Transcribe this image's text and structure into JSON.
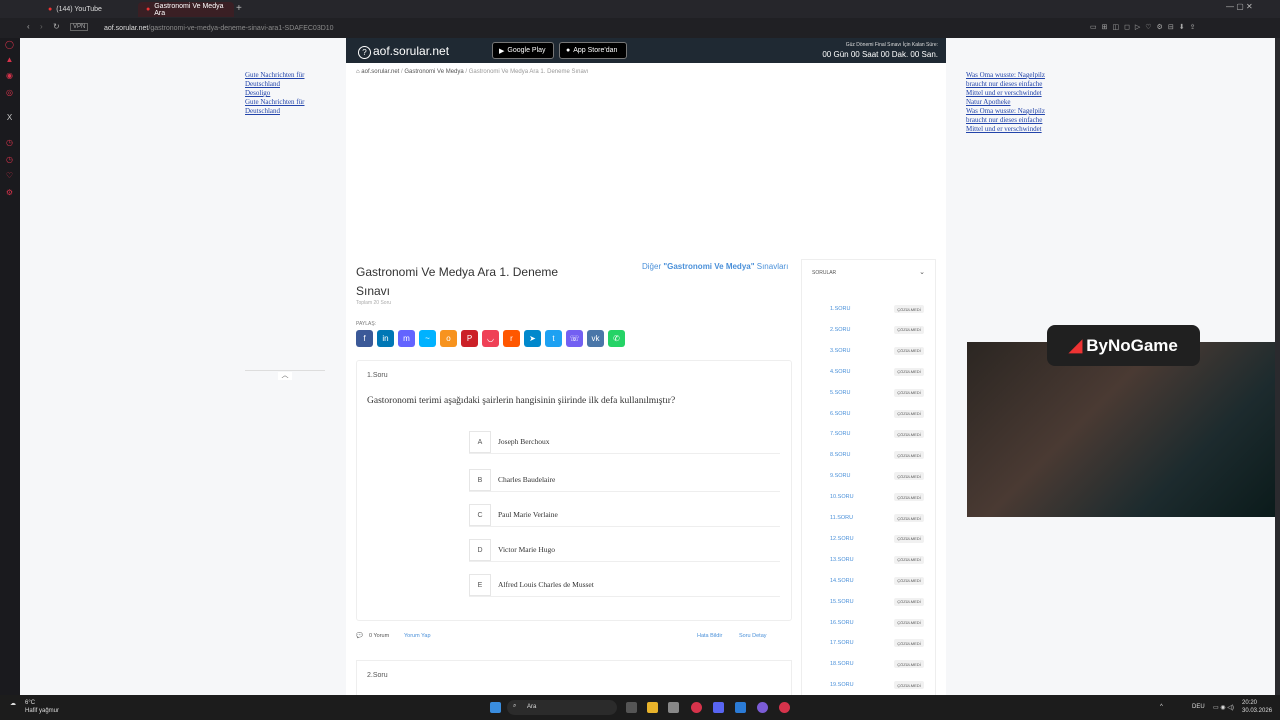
{
  "browser": {
    "tabs": [
      {
        "label": "(144) YouTube"
      },
      {
        "label": "Gastronomi Ve Medya Ara"
      }
    ],
    "url_host": "aof.sorular.net",
    "url_path": "/gastronomi-ve-medya-deneme-sinavi-ara1-SDAFEC03D10",
    "vpn_label": "VPN"
  },
  "header": {
    "logo": "aof.sorular.net",
    "google_play": "Google Play",
    "app_store": "App Store'dan",
    "countdown_label": "Güz Dönemi Final Sınavı İçin Kalan Süre:",
    "countdown": "00 Gün 00 Saat 00 Dak. 00 San."
  },
  "breadcrumb": {
    "home": "aof.sorular.net",
    "category": "Gastronomi Ve Medya",
    "current": "Gastronomi Ve Medya Ara 1. Deneme Sınavı"
  },
  "exam": {
    "title": "Gastronomi Ve Medya Ara 1. Deneme Sınavı",
    "subtitle": "Toplam 20 Soru",
    "other_prefix": "Diğer ",
    "other_bold": "\"Gastronomi Ve Medya\"",
    "other_suffix": " Sınavları",
    "share_label": "PAYLAŞ:"
  },
  "question": {
    "number": "1.Soru",
    "text": "Gastoronomi terimi aşağıdaki şairlerin hangisinin şiirinde ilk defa kullanılmıştır?",
    "options": [
      {
        "letter": "A",
        "text": "Joseph Berchoux"
      },
      {
        "letter": "B",
        "text": "Charles Baudelaire"
      },
      {
        "letter": "C",
        "text": "Paul Marie Verlaine"
      },
      {
        "letter": "D",
        "text": "Victor Marie Hugo"
      },
      {
        "letter": "E",
        "text": "Alfred Louis Charles de Musset"
      }
    ],
    "comments": "0 Yorum",
    "comment_link": "Yorum Yap",
    "report": "Hata Bildir",
    "detail": "Soru Detay"
  },
  "question2": {
    "number": "2.Soru"
  },
  "question_list": {
    "title": "SORULAR",
    "items": [
      {
        "n": "1.SORU",
        "s": "ÇÖZÜLMEDİ"
      },
      {
        "n": "2.SORU",
        "s": "ÇÖZÜLMEDİ"
      },
      {
        "n": "3.SORU",
        "s": "ÇÖZÜLMEDİ"
      },
      {
        "n": "4.SORU",
        "s": "ÇÖZÜLMEDİ"
      },
      {
        "n": "5.SORU",
        "s": "ÇÖZÜLMEDİ"
      },
      {
        "n": "6.SORU",
        "s": "ÇÖZÜLMEDİ"
      },
      {
        "n": "7.SORU",
        "s": "ÇÖZÜLMEDİ"
      },
      {
        "n": "8.SORU",
        "s": "ÇÖZÜLMEDİ"
      },
      {
        "n": "9.SORU",
        "s": "ÇÖZÜLMEDİ"
      },
      {
        "n": "10.SORU",
        "s": "ÇÖZÜLMEDİ"
      },
      {
        "n": "11.SORU",
        "s": "ÇÖZÜLMEDİ"
      },
      {
        "n": "12.SORU",
        "s": "ÇÖZÜLMEDİ"
      },
      {
        "n": "13.SORU",
        "s": "ÇÖZÜLMEDİ"
      },
      {
        "n": "14.SORU",
        "s": "ÇÖZÜLMEDİ"
      },
      {
        "n": "15.SORU",
        "s": "ÇÖZÜLMEDİ"
      },
      {
        "n": "16.SORU",
        "s": "ÇÖZÜLMEDİ"
      },
      {
        "n": "17.SORU",
        "s": "ÇÖZÜLMEDİ"
      },
      {
        "n": "18.SORU",
        "s": "ÇÖZÜLMEDİ"
      },
      {
        "n": "19.SORU",
        "s": "ÇÖZÜLMEDİ"
      }
    ]
  },
  "ads": {
    "left": [
      "Gute Nachrichten für Deutschland",
      "Desoligo",
      "Gute Nachrichten für Deutschland"
    ],
    "right": [
      "Was Oma wusste: Nagelpilz braucht nur dieses einfache Mittel und er verschwindet",
      "Natur Apotheke",
      "Was Oma wusste: Nagelpilz braucht nur dieses einfache Mittel und er verschwindet"
    ]
  },
  "stream": {
    "badge": "ByNoGame"
  },
  "taskbar": {
    "weather_temp": "6°C",
    "weather_desc": "Hafif yağmur",
    "search": "Ara",
    "lang": "DEU",
    "time": "20:20",
    "date": "30.03.2026"
  }
}
